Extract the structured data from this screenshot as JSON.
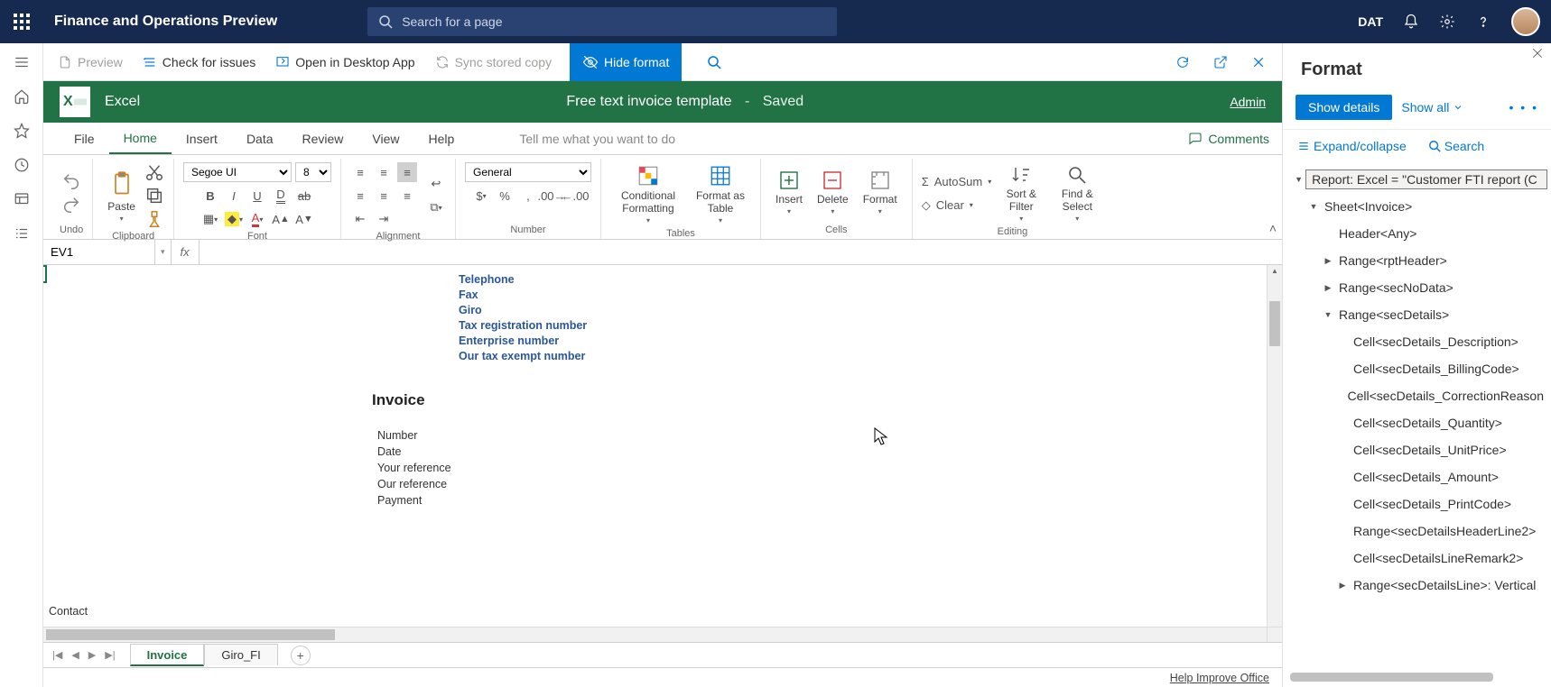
{
  "topbar": {
    "title": "Finance and Operations Preview",
    "search_placeholder": "Search for a page",
    "env": "DAT"
  },
  "actionbar": {
    "preview": "Preview",
    "check": "Check for issues",
    "open_desktop": "Open in Desktop App",
    "sync": "Sync stored copy",
    "hide_format": "Hide format"
  },
  "excel": {
    "appname": "Excel",
    "docname": "Free text invoice template",
    "status": "Saved",
    "user": "Admin",
    "tabs": [
      "File",
      "Home",
      "Insert",
      "Data",
      "Review",
      "View",
      "Help"
    ],
    "active_tab": "Home",
    "tell_me": "Tell me what you want to do",
    "comments": "Comments",
    "ribbon": {
      "undo": "Undo",
      "paste": "Paste",
      "clipboard": "Clipboard",
      "font_name": "Segoe UI",
      "font_size": "8",
      "font_group": "Font",
      "alignment": "Alignment",
      "number_format": "General",
      "number_group": "Number",
      "cond_fmt": "Conditional Formatting",
      "fmt_table": "Format as Table",
      "tables": "Tables",
      "insert": "Insert",
      "delete": "Delete",
      "format": "Format",
      "cells": "Cells",
      "autosum": "AutoSum",
      "clear": "Clear",
      "sort_filter": "Sort & Filter",
      "find_select": "Find & Select",
      "editing": "Editing"
    },
    "namebox": "EV1",
    "formula": "",
    "sheet_fields_blue": [
      "Telephone",
      "Fax",
      "Giro",
      "Tax registration number",
      "Enterprise number",
      "Our tax exempt number"
    ],
    "invoice_title": "Invoice",
    "sheet_fields_plain": [
      "Number",
      "Date",
      "Your reference",
      "Our reference",
      "Payment"
    ],
    "contact_label": "Contact",
    "sheet_tabs": [
      "Invoice",
      "Giro_FI"
    ],
    "active_sheet": "Invoice",
    "help_improve": "Help Improve Office"
  },
  "format_panel": {
    "title": "Format",
    "show_details": "Show details",
    "show_all": "Show all",
    "expand": "Expand/collapse",
    "search": "Search",
    "tree": [
      {
        "depth": 0,
        "twisty": "open",
        "label": "Report: Excel = \"Customer FTI report (C",
        "selected": true
      },
      {
        "depth": 1,
        "twisty": "open",
        "label": "Sheet<Invoice>"
      },
      {
        "depth": 2,
        "twisty": "none",
        "label": "Header<Any>"
      },
      {
        "depth": 2,
        "twisty": "closed",
        "label": "Range<rptHeader>"
      },
      {
        "depth": 2,
        "twisty": "closed",
        "label": "Range<secNoData>"
      },
      {
        "depth": 2,
        "twisty": "open",
        "label": "Range<secDetails>"
      },
      {
        "depth": 3,
        "twisty": "none",
        "label": "Cell<secDetails_Description>"
      },
      {
        "depth": 3,
        "twisty": "none",
        "label": "Cell<secDetails_BillingCode>"
      },
      {
        "depth": 3,
        "twisty": "none",
        "label": "Cell<secDetails_CorrectionReason"
      },
      {
        "depth": 3,
        "twisty": "none",
        "label": "Cell<secDetails_Quantity>"
      },
      {
        "depth": 3,
        "twisty": "none",
        "label": "Cell<secDetails_UnitPrice>"
      },
      {
        "depth": 3,
        "twisty": "none",
        "label": "Cell<secDetails_Amount>"
      },
      {
        "depth": 3,
        "twisty": "none",
        "label": "Cell<secDetails_PrintCode>"
      },
      {
        "depth": 3,
        "twisty": "none",
        "label": "Range<secDetailsHeaderLine2>"
      },
      {
        "depth": 3,
        "twisty": "none",
        "label": "Cell<secDetailsLineRemark2>"
      },
      {
        "depth": 3,
        "twisty": "closed",
        "label": "Range<secDetailsLine>: Vertical"
      }
    ]
  }
}
